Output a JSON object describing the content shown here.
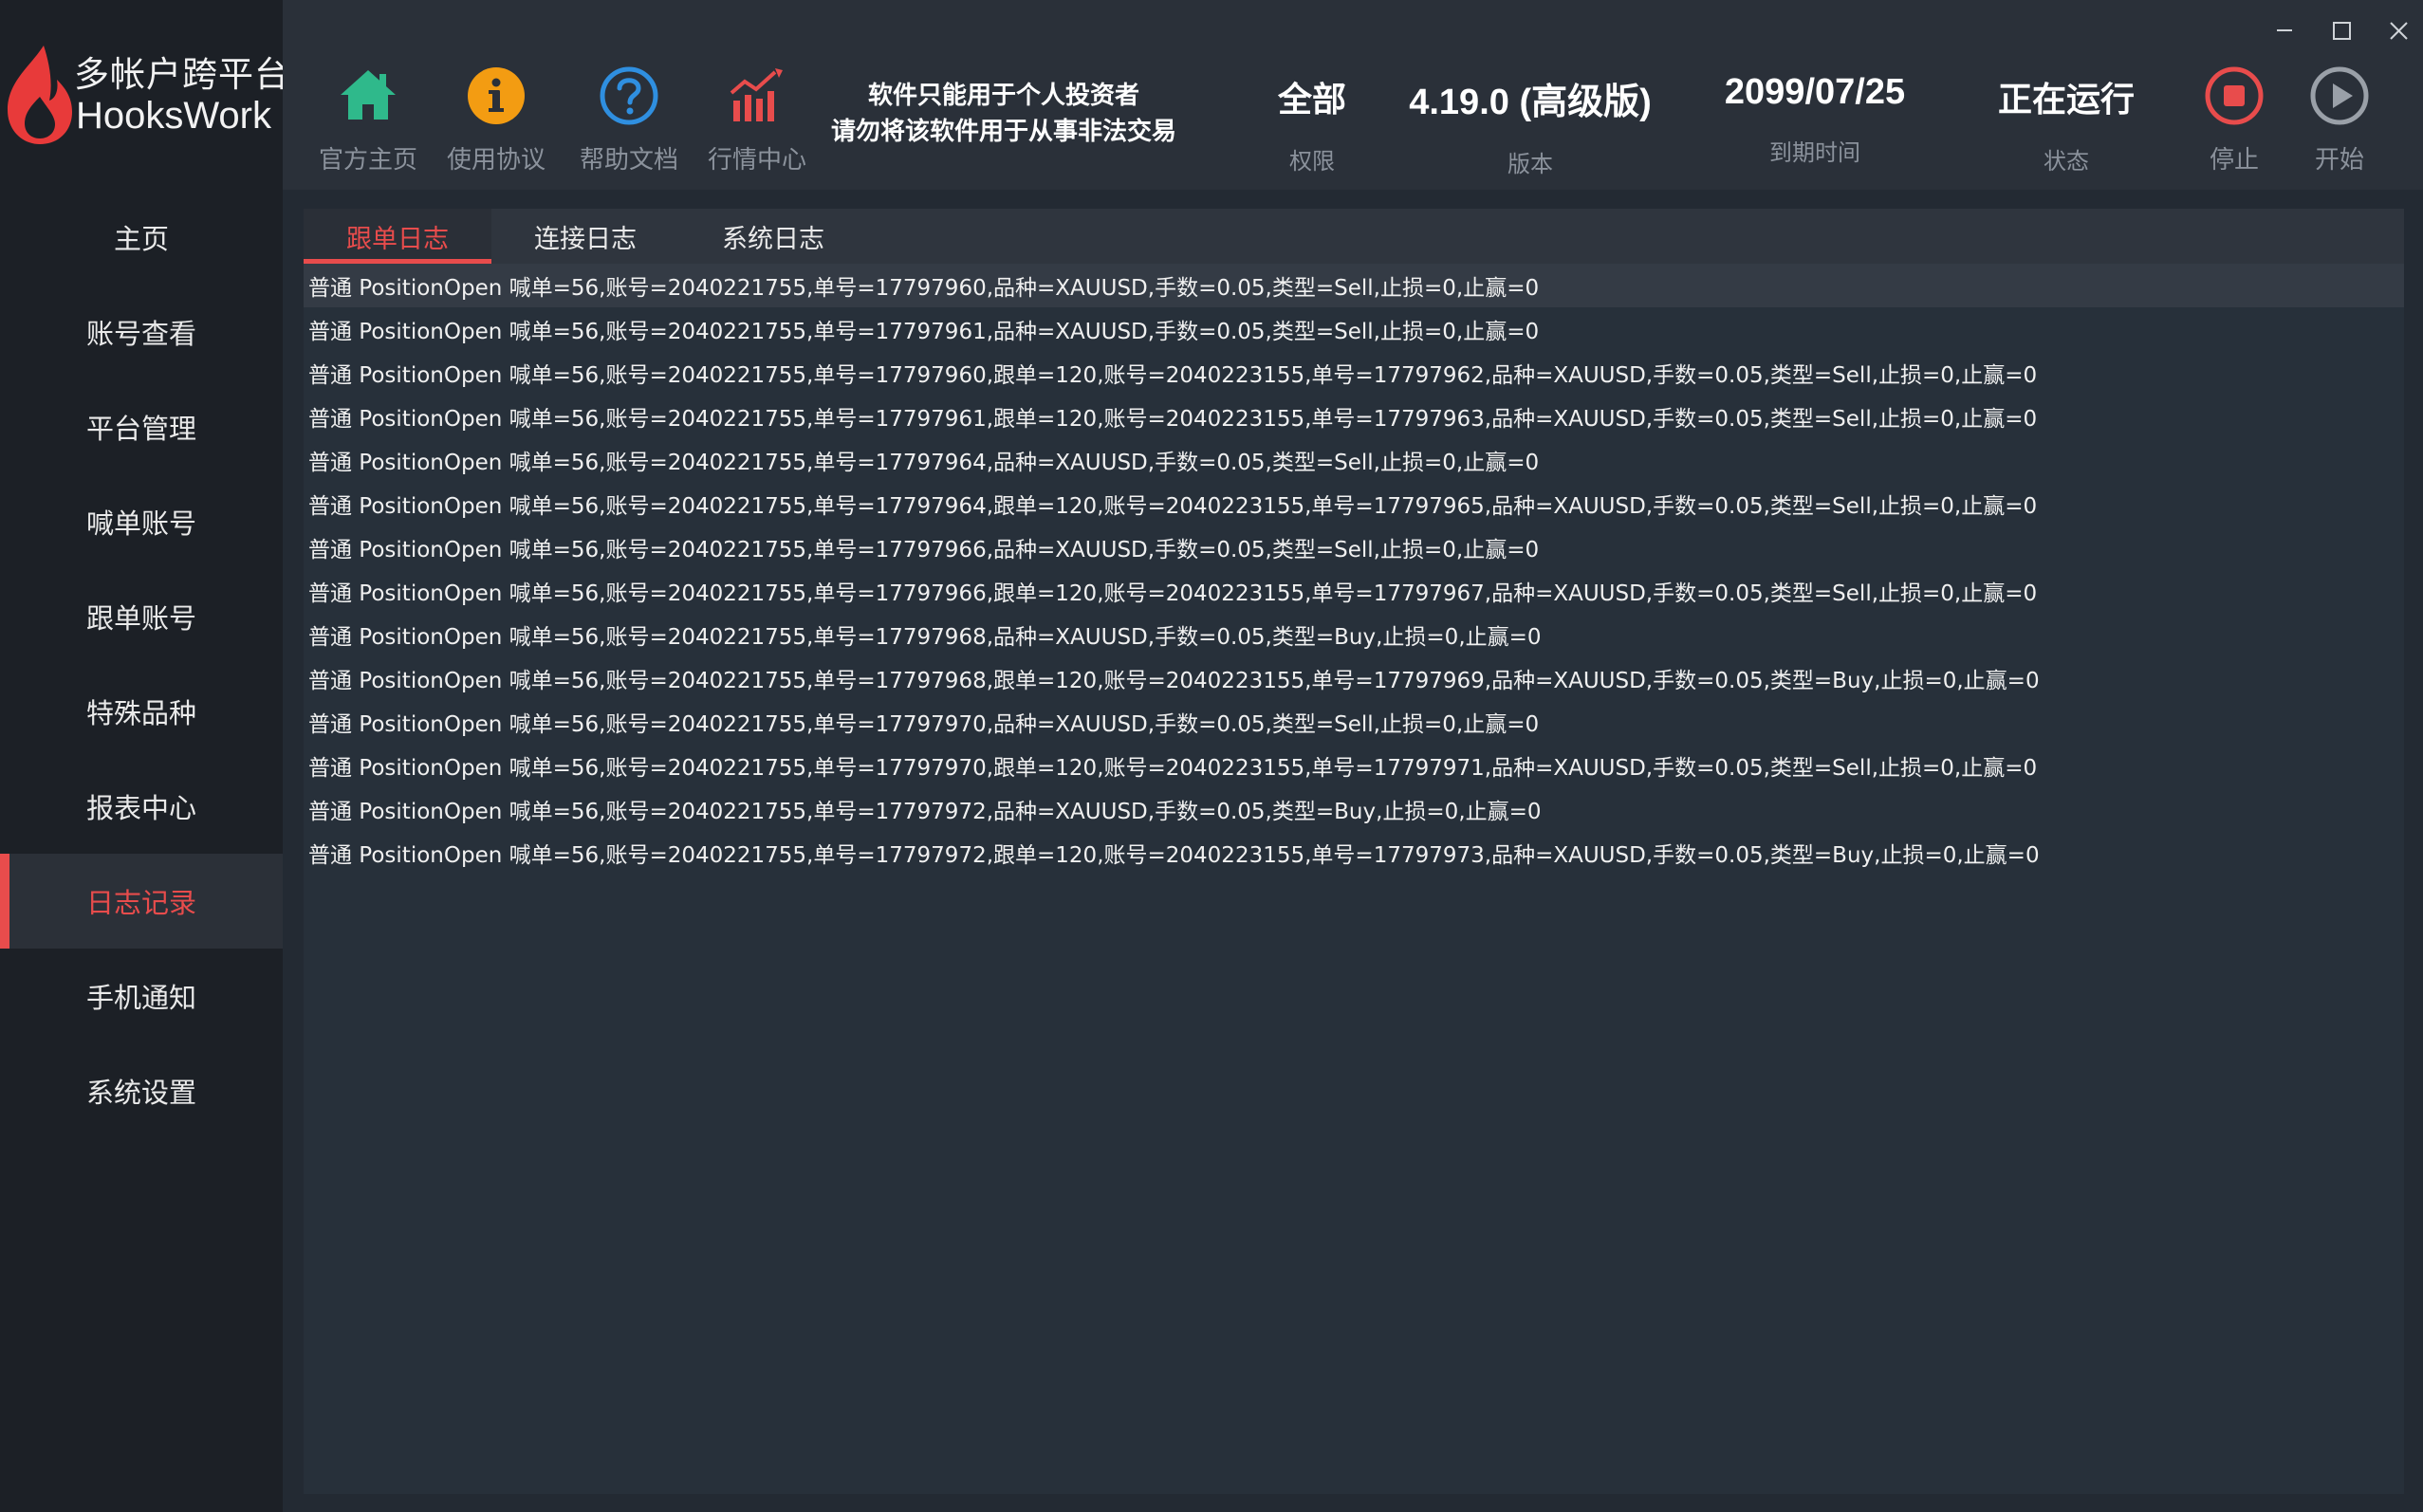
{
  "app": {
    "title_cn": "多帐户跨平台",
    "title_en": "HooksWork"
  },
  "sidebar": {
    "items": [
      {
        "label": "主页"
      },
      {
        "label": "账号查看"
      },
      {
        "label": "平台管理"
      },
      {
        "label": "喊单账号"
      },
      {
        "label": "跟单账号"
      },
      {
        "label": "特殊品种"
      },
      {
        "label": "报表中心"
      },
      {
        "label": "日志记录",
        "active": true
      },
      {
        "label": "手机通知"
      },
      {
        "label": "系统设置"
      }
    ]
  },
  "toolbar": {
    "tools": [
      {
        "label": "官方主页",
        "icon": "home-icon"
      },
      {
        "label": "使用协议",
        "icon": "info-icon"
      },
      {
        "label": "帮助文档",
        "icon": "help-icon"
      },
      {
        "label": "行情中心",
        "icon": "chart-icon"
      }
    ],
    "notice_line1": "软件只能用于个人投资者",
    "notice_line2": "请勿将该软件用于从事非法交易",
    "permission": {
      "value": "全部",
      "caption": "权限"
    },
    "version": {
      "value": "4.19.0 (高级版)",
      "caption": "版本"
    },
    "expiry": {
      "value": "2099/07/25",
      "caption": "到期时间"
    },
    "status": {
      "value": "正在运行",
      "caption": "状态"
    },
    "stop_label": "停止",
    "start_label": "开始"
  },
  "colors": {
    "accent": "#e84c4c",
    "home_icon": "#2fb98b",
    "info_icon": "#f39c12",
    "help_icon": "#2f8fe0",
    "chart_icon": "#e84c4c",
    "stop_icon": "#e84c4c",
    "start_icon": "#9aa0a8"
  },
  "tabs": [
    {
      "label": "跟单日志",
      "active": true
    },
    {
      "label": "连接日志"
    },
    {
      "label": "系统日志"
    }
  ],
  "logs": [
    "普通 PositionOpen 喊单=56,账号=2040221755,单号=17797960,品种=XAUUSD,手数=0.05,类型=Sell,止损=0,止赢=0",
    "普通 PositionOpen 喊单=56,账号=2040221755,单号=17797961,品种=XAUUSD,手数=0.05,类型=Sell,止损=0,止赢=0",
    "普通 PositionOpen 喊单=56,账号=2040221755,单号=17797960,跟单=120,账号=2040223155,单号=17797962,品种=XAUUSD,手数=0.05,类型=Sell,止损=0,止赢=0",
    "普通 PositionOpen 喊单=56,账号=2040221755,单号=17797961,跟单=120,账号=2040223155,单号=17797963,品种=XAUUSD,手数=0.05,类型=Sell,止损=0,止赢=0",
    "普通 PositionOpen 喊单=56,账号=2040221755,单号=17797964,品种=XAUUSD,手数=0.05,类型=Sell,止损=0,止赢=0",
    "普通 PositionOpen 喊单=56,账号=2040221755,单号=17797964,跟单=120,账号=2040223155,单号=17797965,品种=XAUUSD,手数=0.05,类型=Sell,止损=0,止赢=0",
    "普通 PositionOpen 喊单=56,账号=2040221755,单号=17797966,品种=XAUUSD,手数=0.05,类型=Sell,止损=0,止赢=0",
    "普通 PositionOpen 喊单=56,账号=2040221755,单号=17797966,跟单=120,账号=2040223155,单号=17797967,品种=XAUUSD,手数=0.05,类型=Sell,止损=0,止赢=0",
    "普通 PositionOpen 喊单=56,账号=2040221755,单号=17797968,品种=XAUUSD,手数=0.05,类型=Buy,止损=0,止赢=0",
    "普通 PositionOpen 喊单=56,账号=2040221755,单号=17797968,跟单=120,账号=2040223155,单号=17797969,品种=XAUUSD,手数=0.05,类型=Buy,止损=0,止赢=0",
    "普通 PositionOpen 喊单=56,账号=2040221755,单号=17797970,品种=XAUUSD,手数=0.05,类型=Sell,止损=0,止赢=0",
    "普通 PositionOpen 喊单=56,账号=2040221755,单号=17797970,跟单=120,账号=2040223155,单号=17797971,品种=XAUUSD,手数=0.05,类型=Sell,止损=0,止赢=0",
    "普通 PositionOpen 喊单=56,账号=2040221755,单号=17797972,品种=XAUUSD,手数=0.05,类型=Buy,止损=0,止赢=0",
    "普通 PositionOpen 喊单=56,账号=2040221755,单号=17797972,跟单=120,账号=2040223155,单号=17797973,品种=XAUUSD,手数=0.05,类型=Buy,止损=0,止赢=0"
  ]
}
